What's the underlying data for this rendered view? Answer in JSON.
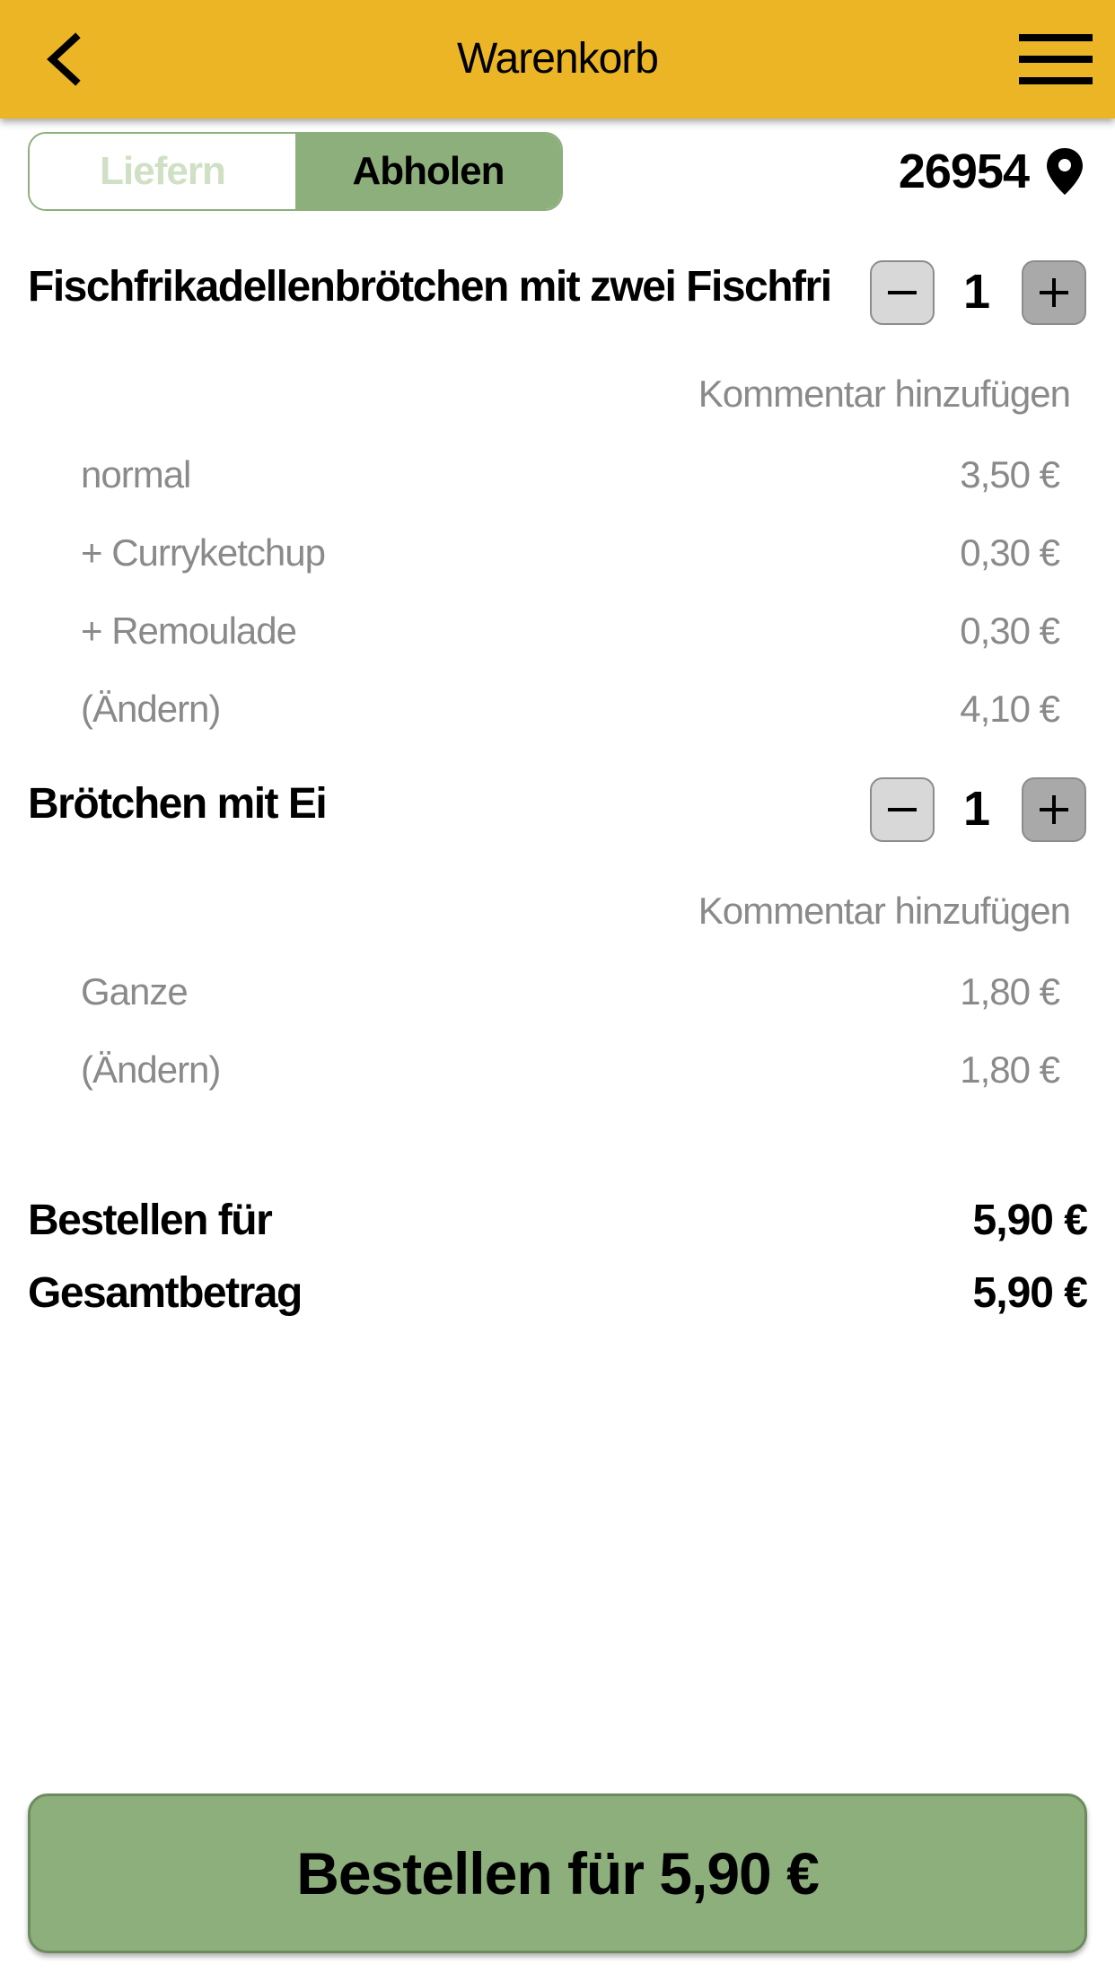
{
  "header": {
    "title": "Warenkorb",
    "back_icon": "chevron-left-icon",
    "menu_icon": "hamburger-menu-icon",
    "background_color": "#ebb526"
  },
  "delivery_toggle": {
    "options": [
      "Liefern",
      "Abholen"
    ],
    "selected": "Abholen",
    "accent_color": "#8daf7c"
  },
  "location": {
    "postcode": "26954",
    "icon": "location-pin-icon"
  },
  "cart": {
    "items": [
      {
        "name": "Fischfrikadellenbrötchen mit zwei Fischfri",
        "quantity": "1",
        "comment_label": "Kommentar hinzufügen",
        "options": [
          {
            "label": "normal",
            "price": "3,50 €"
          },
          {
            "label": "+ Curryketchup",
            "price": "0,30 €"
          },
          {
            "label": "+ Remoulade",
            "price": "0,30 €"
          },
          {
            "label": "(Ändern)",
            "price": "4,10 €"
          }
        ]
      },
      {
        "name": "Brötchen mit Ei",
        "quantity": "1",
        "comment_label": "Kommentar hinzufügen",
        "options": [
          {
            "label": "Ganze",
            "price": "1,80 €"
          },
          {
            "label": "(Ändern)",
            "price": "1,80 €"
          }
        ]
      }
    ]
  },
  "summary": {
    "order_for_label": "Bestellen für",
    "order_for_value": "5,90 €",
    "total_label": "Gesamtbetrag",
    "total_value": "5,90 €"
  },
  "order_button": {
    "label": "Bestellen für 5,90 €"
  }
}
